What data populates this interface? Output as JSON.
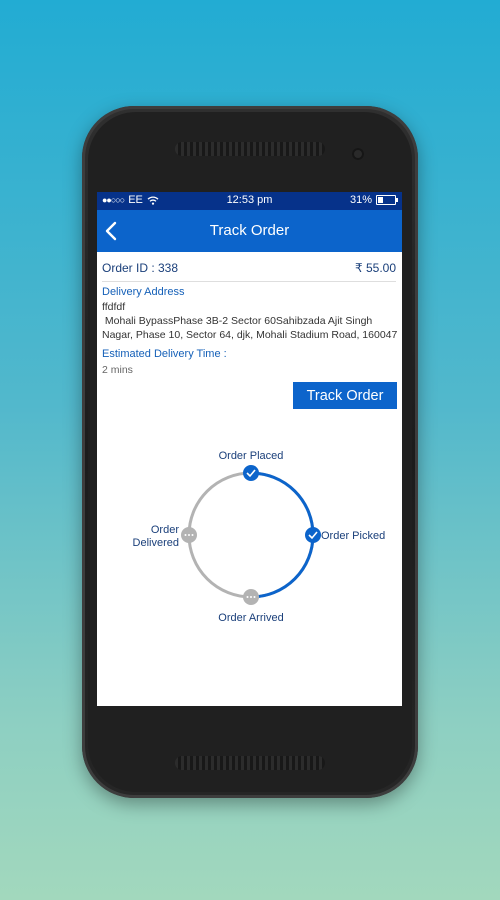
{
  "status_bar": {
    "carrier": "EE",
    "signal": "●●○○○",
    "time": "12:53 pm",
    "battery": "31%"
  },
  "app_bar": {
    "title": "Track Order"
  },
  "order": {
    "id_label": "Order ID : 338",
    "amount": "₹ 55.00",
    "address_label": "Delivery Address",
    "address_name": "ffdfdf",
    "address_line1": " Mohali BypassPhase 3B-2 Sector 60Sahibzada Ajit Singh",
    "address_line2": "Nagar, Phase 10, Sector 64, djk, Mohali Stadium Road, 160047",
    "eta_label": "Estimated Delivery Time :",
    "eta_value": "2 mins"
  },
  "track_button": "Track Order",
  "tracker": {
    "stages": [
      {
        "name": "Order Placed",
        "status": "done"
      },
      {
        "name": "Order Picked",
        "status": "done"
      },
      {
        "name": "Order Arrived",
        "status": "pending"
      },
      {
        "name": "Order Delivered",
        "status": "pending"
      }
    ],
    "delivered_line1": "Order",
    "delivered_line2": "Delivered",
    "colors": {
      "done": "#0c64cb",
      "pending": "#b3b3b3"
    }
  }
}
